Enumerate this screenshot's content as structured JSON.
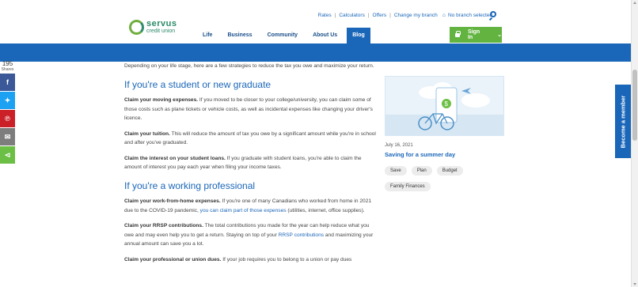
{
  "brand": {
    "name": "servus",
    "sub": "credit union",
    "green": "#62b33f",
    "blue": "#1a66b8"
  },
  "utility_nav": {
    "links": [
      "Rates",
      "Calculators",
      "Offers",
      "Change my branch"
    ],
    "branch": "No branch selected"
  },
  "main_nav": {
    "items": [
      "Life",
      "Business",
      "Community",
      "About Us",
      "Blog"
    ],
    "active": "Blog"
  },
  "signin": {
    "label": "Sign In"
  },
  "share": {
    "count": "195",
    "count_label": "Shares",
    "buttons": [
      {
        "icon": "facebook-icon",
        "glyph": "f",
        "color": "#3b5998"
      },
      {
        "icon": "twitter-icon",
        "glyph": "t",
        "color": "#1da1f2"
      },
      {
        "icon": "pinterest-icon",
        "glyph": "p",
        "color": "#cb2027"
      },
      {
        "icon": "email-icon",
        "glyph": "✉",
        "color": "#7d7d7d"
      },
      {
        "icon": "share-icon",
        "glyph": "<",
        "color": "#6cbf45"
      }
    ]
  },
  "article": {
    "intro": "Depending on your life stage, here are a few strategies to reduce the tax you owe and maximize your return.",
    "section1_heading": "If you're a student or new graduate",
    "p1_bold": "Claim your moving expenses.",
    "p1_text": " If you moved to be closer to your college/university, you can claim some of those costs such as plane tickets or vehicle costs, as well as incidental expenses like changing your driver's licence.",
    "p2_bold": "Claim your tuition.",
    "p2_text": " This will reduce the amount of tax you owe by a significant amount while you're in school and after you've graduated.",
    "p3_bold": "Claim the interest on your student loans.",
    "p3_text": " If you graduate with student loans, you're able to claim the amount of interest you pay each year when filing your income taxes.",
    "section2_heading": "If you're a working professional",
    "p4_bold": "Claim your work-from-home expenses.",
    "p4_text_a": " If you're one of many Canadians who worked from home in 2021 due to the COVID-19 pandemic, ",
    "p4_link": "you can claim part of those expenses",
    "p4_text_b": " (utilities, internet, office supplies).",
    "p5_bold": "Claim your RRSP contributions.",
    "p5_text_a": " The total contributions you made for the year can help reduce what you owe and may even help you to get a return. Staying on top of your ",
    "p5_link": "RRSP contributions",
    "p5_text_b": " and maximizing your annual amount can save you a lot.",
    "p6_bold": "Claim your professional or union dues.",
    "p6_text": " If your job requires you to belong to a union or pay dues"
  },
  "related": {
    "date": "July 16, 2021",
    "title": "Saving for a summer day",
    "tags": [
      "Save",
      "Plan",
      "Budget",
      "Family Finances"
    ]
  },
  "member_tab": {
    "label": "Become a member"
  }
}
